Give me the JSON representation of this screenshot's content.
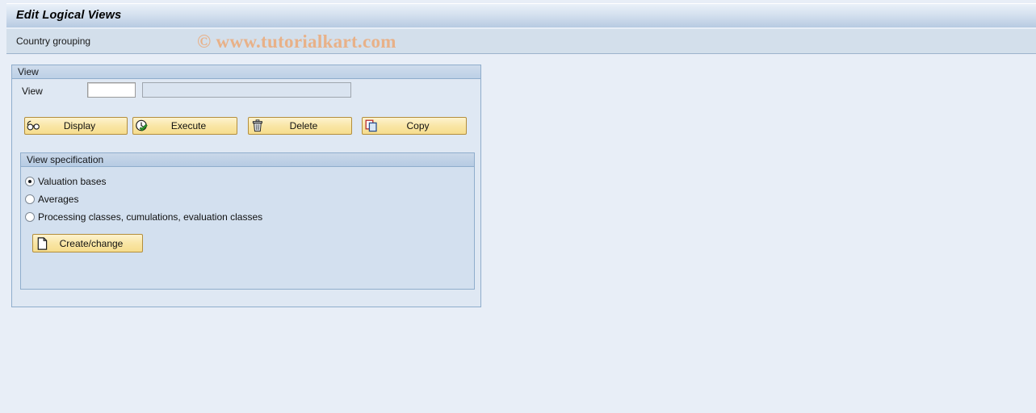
{
  "window": {
    "title": "Edit Logical Views",
    "subtitle": "Country grouping",
    "watermark": "© www.tutorialkart.com"
  },
  "colors": {
    "background": "#e8eef7",
    "title_bar_top": "#eaf1f9",
    "title_bar_bottom": "#b8cbe2",
    "subtitle_bar": "#d3dfeb",
    "group_panel": "#dfe8f3",
    "inner_panel": "#d3e0ef",
    "panel_border": "#8fadcc",
    "button_face": "#f9e6a6",
    "button_border": "#b38e3c",
    "watermark_text": "#e8b188",
    "field_enabled": "#ffffff",
    "field_disabled": "#dae4f0"
  },
  "view_group": {
    "header": "View",
    "field_label": "View",
    "view_input": {
      "value": "",
      "placeholder": ""
    },
    "view_description": {
      "value": "",
      "placeholder": ""
    },
    "buttons": [
      {
        "label": "Display",
        "icon": "glasses-icon"
      },
      {
        "label": "Execute",
        "icon": "clock-check-icon"
      },
      {
        "label": "Delete",
        "icon": "trash-icon"
      },
      {
        "label": "Copy",
        "icon": "copy-icon"
      }
    ]
  },
  "view_specification": {
    "header": "View specification",
    "options": [
      {
        "label": "Valuation bases",
        "selected": true
      },
      {
        "label": "Averages",
        "selected": false
      },
      {
        "label": "Processing classes, cumulations, evaluation classes",
        "selected": false
      }
    ],
    "create_change_button": {
      "label": "Create/change",
      "icon": "document-icon"
    }
  }
}
